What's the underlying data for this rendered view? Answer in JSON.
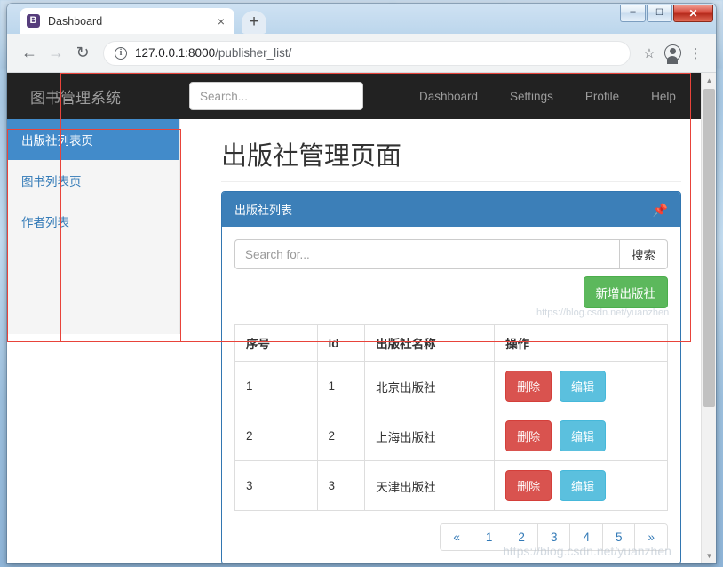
{
  "browser": {
    "tab": {
      "title": "Dashboard",
      "favicon_letter": "B",
      "close_icon": "×"
    },
    "new_tab_icon": "+",
    "window_controls": {
      "minimize": "—",
      "maximize": "❐",
      "close": "✕"
    },
    "nav": {
      "back_icon": "←",
      "forward_icon": "→",
      "reload_icon": "↻",
      "info_icon": "i",
      "url_host": "127.0.0.1:8000",
      "url_path": "/publisher_list/",
      "star_icon": "☆",
      "menu_icon": "⋮"
    },
    "scrollbar": {
      "up_arrow": "▲",
      "down_arrow": "▼"
    }
  },
  "navbar": {
    "brand": "图书管理系统",
    "search_placeholder": "Search...",
    "links": [
      "Dashboard",
      "Settings",
      "Profile",
      "Help"
    ]
  },
  "sidebar": {
    "items": [
      {
        "label": "出版社列表页",
        "active": true
      },
      {
        "label": "图书列表页",
        "active": false
      },
      {
        "label": "作者列表",
        "active": false
      }
    ]
  },
  "main": {
    "page_title": "出版社管理页面",
    "panel": {
      "heading": "出版社列表",
      "pin_icon": "📌",
      "search_placeholder": "Search for...",
      "search_button": "搜索",
      "add_button": "新增出版社"
    },
    "table": {
      "columns": [
        "序号",
        "id",
        "出版社名称",
        "操作"
      ],
      "rows": [
        {
          "seq": "1",
          "id": "1",
          "name": "北京出版社",
          "delete": "删除",
          "edit": "编辑"
        },
        {
          "seq": "2",
          "id": "2",
          "name": "上海出版社",
          "delete": "删除",
          "edit": "编辑"
        },
        {
          "seq": "3",
          "id": "3",
          "name": "天津出版社",
          "delete": "删除",
          "edit": "编辑"
        }
      ]
    },
    "pagination": [
      "«",
      "1",
      "2",
      "3",
      "4",
      "5",
      "»"
    ]
  },
  "watermark": {
    "top": "https://blog.csdn.net/yuanzhen",
    "bottom": "https://blog.csdn.net/yuanzhen"
  },
  "colors": {
    "navbar_bg": "#222222",
    "panel_header": "#3c7fb8",
    "sidebar_active": "#428bca",
    "btn_add": "#5cb85c",
    "btn_delete": "#d9534f",
    "btn_edit": "#5bc0de",
    "link": "#337ab7",
    "annotation": "#e8433a"
  }
}
